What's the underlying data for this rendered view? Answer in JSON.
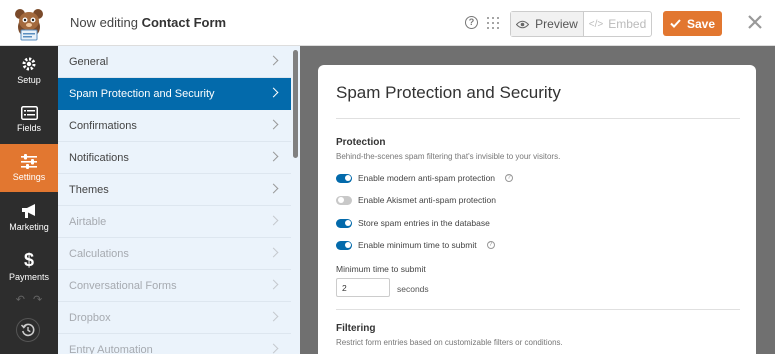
{
  "header": {
    "editing_prefix": "Now editing",
    "form_name": "Contact Form",
    "preview_label": "Preview",
    "embed_label": "Embed",
    "save_label": "Save",
    "accent_color": "#e27730"
  },
  "rail": {
    "items": [
      {
        "label": "Setup",
        "icon": "gear-icon"
      },
      {
        "label": "Fields",
        "icon": "list-icon"
      },
      {
        "label": "Settings",
        "icon": "sliders-icon",
        "active": true
      },
      {
        "label": "Marketing",
        "icon": "megaphone-icon"
      },
      {
        "label": "Payments",
        "icon": "dollar-icon"
      }
    ]
  },
  "panel": {
    "items": [
      {
        "label": "General"
      },
      {
        "label": "Spam Protection and Security",
        "active": true
      },
      {
        "label": "Confirmations"
      },
      {
        "label": "Notifications"
      },
      {
        "label": "Themes"
      },
      {
        "label": "Airtable",
        "muted": true
      },
      {
        "label": "Calculations",
        "muted": true
      },
      {
        "label": "Conversational Forms",
        "muted": true
      },
      {
        "label": "Dropbox",
        "muted": true
      },
      {
        "label": "Entry Automation",
        "muted": true
      }
    ],
    "active_color": "#036aab"
  },
  "content": {
    "title": "Spam Protection and Security",
    "protection": {
      "heading": "Protection",
      "description": "Behind-the-scenes spam filtering that's invisible to your visitors.",
      "toggles": [
        {
          "label": "Enable modern anti-spam protection",
          "on": true,
          "help": true
        },
        {
          "label": "Enable Akismet anti-spam protection",
          "on": false,
          "help": false
        },
        {
          "label": "Store spam entries in the database",
          "on": true,
          "help": false
        },
        {
          "label": "Enable minimum time to submit",
          "on": true,
          "help": true
        }
      ],
      "min_time_label": "Minimum time to submit",
      "min_time_value": "2",
      "min_time_unit": "seconds"
    },
    "filtering": {
      "heading": "Filtering",
      "description": "Restrict form entries based on customizable filters or conditions."
    }
  }
}
